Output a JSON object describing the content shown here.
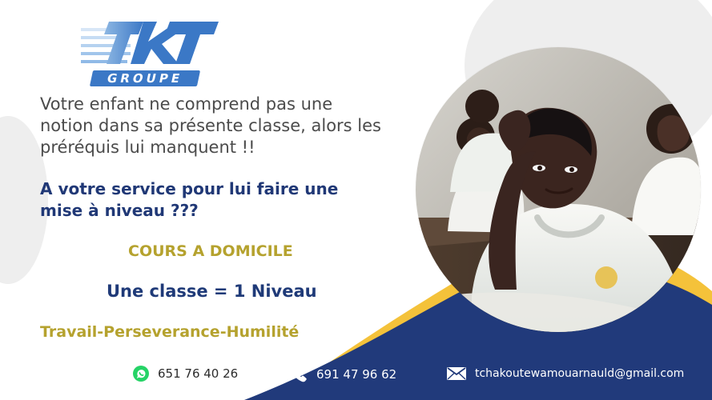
{
  "brand": {
    "logo_text": "KT",
    "badge_text": "GROUPE"
  },
  "headline": {
    "line1": "Votre enfant ne comprend pas une",
    "line2": "notion dans sa présente classe, alors les",
    "line3": "préréquis lui manquent !!"
  },
  "service": {
    "line1": "A votre service pour lui faire une",
    "line2": "mise à niveau ???"
  },
  "offer": {
    "title": "COURS A DOMICILE",
    "class_level": "Une classe = 1 Niveau",
    "motto": "Travail-Perseverance-Humilité"
  },
  "contacts": {
    "whatsapp_number": "651 76 40 26",
    "phone_number": "691 47 96 62",
    "email": "tchakoutewamouarnauld@gmail.com"
  },
  "icons": {
    "whatsapp": "whatsapp-icon",
    "phone": "phone-icon",
    "email": "email-icon"
  },
  "colors": {
    "navy": "#213a7b",
    "gold": "#f4c23a",
    "light_gray": "#eeeeee",
    "blue": "#3b78c6",
    "text_gray": "#4b4b4b",
    "whatsapp_green": "#25d366"
  }
}
